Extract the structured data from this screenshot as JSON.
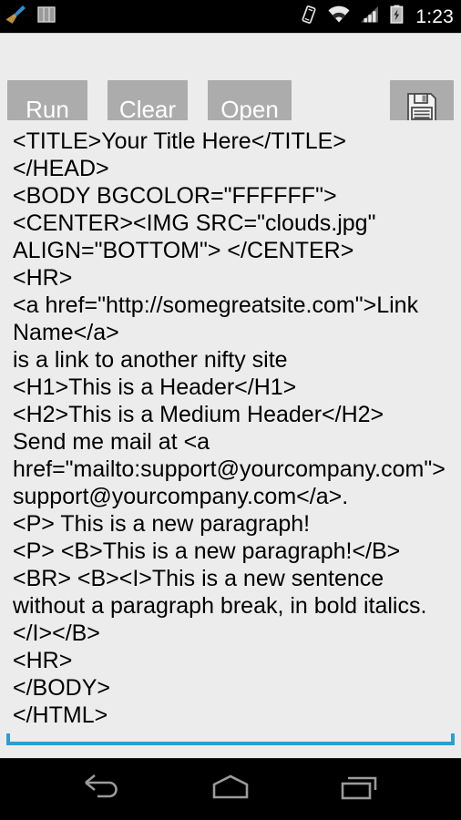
{
  "status_bar": {
    "left_icons": [
      {
        "name": "broom-cleaner-icon",
        "label": "Cleaner"
      },
      {
        "name": "bars-notification-icon",
        "label": "Bars"
      }
    ],
    "right_icons": [
      {
        "name": "vibrate-icon",
        "label": "Vibrate"
      },
      {
        "name": "wifi-icon",
        "label": "Wi-Fi"
      },
      {
        "name": "signal-bars-icon",
        "label": "Signal"
      },
      {
        "name": "battery-charging-icon",
        "label": "Battery charging"
      }
    ],
    "clock": "1:23"
  },
  "toolbar": {
    "run_label": "Run",
    "clear_label": "Clear",
    "open_label": "Open",
    "save_icon": "floppy-disk-save-icon",
    "button_bg": "#ACACAC",
    "button_text_color": "#FFFFFF"
  },
  "editor": {
    "focus_color": "#2B9FD4",
    "background": "#ECECEC",
    "text_color": "#000000",
    "content": "<TITLE>Your Title Here</TITLE>\n</HEAD>\n<BODY BGCOLOR=\"FFFFFF\">\n<CENTER><IMG SRC=\"clouds.jpg\" ALIGN=\"BOTTOM\"> </CENTER>\n<HR>\n<a href=\"http://somegreatsite.com\">Link Name</a>\nis a link to another nifty site\n<H1>This is a Header</H1>\n<H2>This is a Medium Header</H2>\nSend me mail at <a href=\"mailto:support@yourcompany.com\">\nsupport@yourcompany.com</a>.\n<P> This is a new paragraph!\n<P> <B>This is a new paragraph!</B>\n<BR> <B><I>This is a new sentence without a paragraph break, in bold italics.</I></B>\n<HR>\n</BODY>\n</HTML>",
    "lines": [
      "<TITLE>Your Title Here</TITLE>",
      "</HEAD>",
      "<BODY BGCOLOR=\"FFFFFF\">",
      "<CENTER><IMG SRC=\"clouds.jpg\" ALIGN=\"BOTTOM\"> </CENTER>",
      "<HR>",
      "<a href=\"http://somegreatsite.com\">Link Name</a>",
      "is a link to another nifty site",
      "<H1>This is a Header</H1>",
      "<H2>This is a Medium Header</H2>",
      "Send me mail at <a href=\"mailto:support@yourcompany.com\">",
      "support@yourcompany.com</a>.",
      "<P> This is a new paragraph!",
      "<P> <B>This is a new paragraph!</B>",
      "<BR> <B><I>This is a new sentence without a paragraph break, in bold italics.</I></B>",
      "<HR>",
      "</BODY>",
      "</HTML>"
    ]
  },
  "nav_bar": {
    "back_icon": "back-arrow-icon",
    "home_icon": "home-icon",
    "recents_icon": "recent-apps-icon"
  }
}
